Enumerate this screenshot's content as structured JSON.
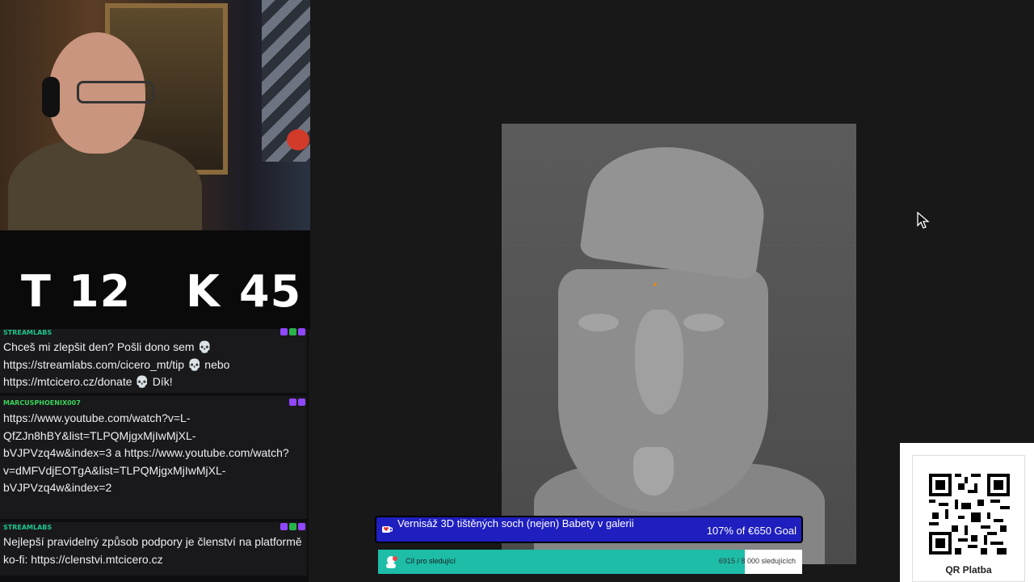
{
  "score": {
    "t_label": "T",
    "t_value": "12",
    "k_label": "K",
    "k_value": "45"
  },
  "chat": {
    "messages": [
      {
        "user": "STREAMLABS",
        "user_color": "#1ec58b",
        "text": "Chceš mi zlepšit den? Pošli dono sem 💀 https://streamlabs.com/cicero_mt/tip 💀 nebo https://mtcicero.cz/donate 💀 Dík!",
        "badges": [
          "#9146ff",
          "#29b24a",
          "#9146ff"
        ]
      },
      {
        "user": "MARCUSPHOENIX007",
        "user_color": "#3cd45a",
        "text": "https://www.youtube.com/watch?v=L-QfZJn8hBY&list=TLPQMjgxMjIwMjXL-bVJPVzq4w&index=3 a https://www.youtube.com/watch?v=dMFVdjEOTgA&list=TLPQMjgxMjIwMjXL-bVJPVzq4w&index=2",
        "badges": [
          "#9146ff",
          "#9146ff"
        ]
      },
      {
        "user": "STREAMLABS",
        "user_color": "#1ec58b",
        "text": "Nejlepší pravidelný způsob podpory je členství na platformě ko-fi: https://clenstvi.mtcicero.cz",
        "badges": [
          "#9146ff",
          "#29b24a",
          "#9146ff"
        ]
      }
    ]
  },
  "goal": {
    "title": "Vernisáž 3D tištěných soch (nejen) Babety v galerii",
    "progress_text": "107% of €650 Goal",
    "color": "#1f1fbf"
  },
  "followers_goal": {
    "label": "Cíl pro sledující",
    "count_text": "6915 / 8 000 sledujících",
    "progress": 0.864,
    "color": "#1dbda8"
  },
  "qr": {
    "label": "QR Platba"
  },
  "icons": {
    "goal": "heart-cup-icon",
    "followers": "follow-icon",
    "cursor": "mouse-pointer-icon"
  }
}
